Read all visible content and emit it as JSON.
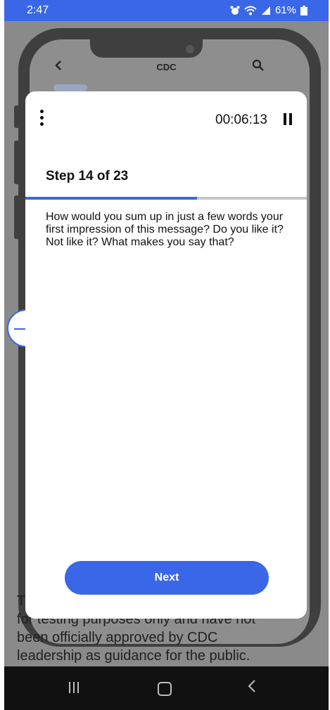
{
  "status_bar": {
    "time": "2:47",
    "battery": "61%",
    "icons": [
      "alarm-icon",
      "wifi-icon",
      "signal-icon",
      "battery-icon"
    ]
  },
  "background_app": {
    "title": "CDC",
    "back_icon": "chevron-left-icon",
    "search_icon": "search-icon",
    "text_lines": [
      "T",
      "for testing purposes only and have not",
      "been officially approved by CDC",
      "leadership as guidance for the public."
    ]
  },
  "modal": {
    "menu_icon": "kebab-menu-icon",
    "timer": "00:06:13",
    "pause_icon": "pause-icon",
    "step_label": "Step 14 of 23",
    "progress": 0.61,
    "question": "How would you sum up in just a few words your first impression of this message? Do you like it? Not like it? What makes you say that?",
    "next_label": "Next"
  },
  "floating_widget": {
    "icon": "minus-icon"
  },
  "nav_bar": {
    "recents_icon": "recents-icon",
    "home_icon": "home-icon",
    "back_icon": "back-icon"
  },
  "colors": {
    "accent": "#3a67e8",
    "overlay": "#8a8a8a",
    "nav": "#111111"
  }
}
